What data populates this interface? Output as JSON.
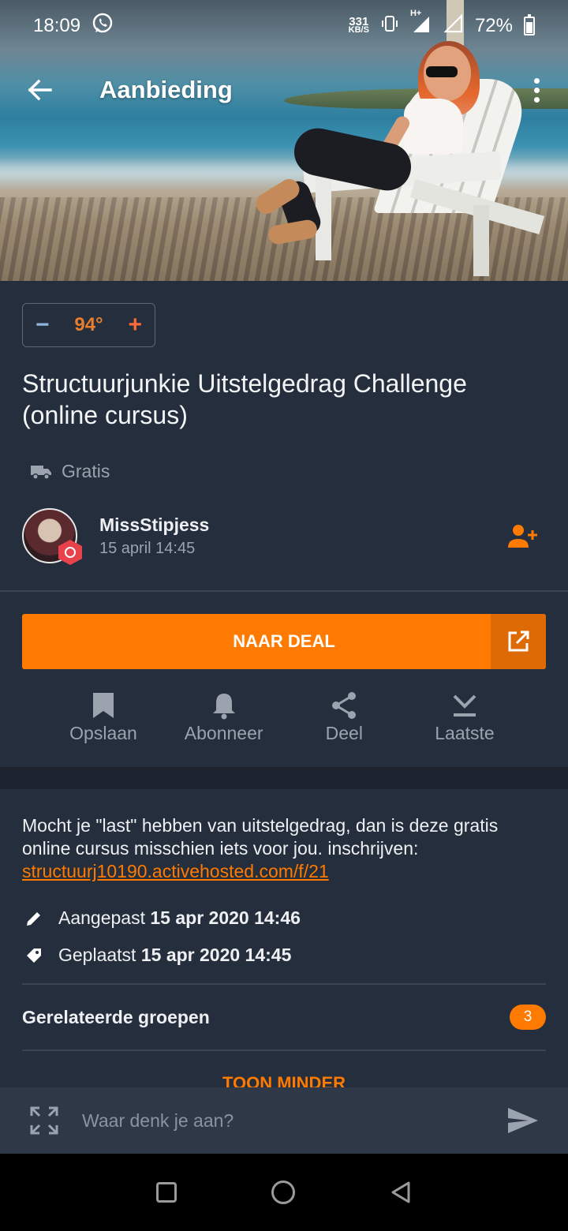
{
  "status_bar": {
    "time": "18:09",
    "net_speed_value": "331",
    "net_speed_unit": "KB/S",
    "network_type": "H+",
    "battery": "72%"
  },
  "app_bar": {
    "title": "Aanbieding"
  },
  "deal": {
    "temperature": "94°",
    "title": "Structuurjunkie Uitstelgedrag Challenge (online cursus)",
    "shipping": "Gratis",
    "poster": {
      "name": "MissStipjess",
      "posted": "15 april 14:45"
    },
    "cta_label": "NAAR DEAL",
    "description": "Mocht je \"last\" hebben van uitstelgedrag, dan is deze gratis online cursus misschien iets voor jou. inschrijven:",
    "link": "structuurj10190.activehosted.com/f/21",
    "edited_label": "Aangepast",
    "edited_date": "15 apr 2020 14:46",
    "placed_label": "Geplaatst",
    "placed_date": "15 apr 2020 14:45"
  },
  "actions": [
    {
      "label": "Opslaan",
      "icon": "bookmark-icon"
    },
    {
      "label": "Abonneer",
      "icon": "bell-icon"
    },
    {
      "label": "Deel",
      "icon": "share-icon"
    },
    {
      "label": "Laatste",
      "icon": "jump-to-latest-icon"
    }
  ],
  "groups": {
    "label": "Gerelateerde groepen",
    "count": "3"
  },
  "toggle_label": "TOON MINDER",
  "comment": {
    "placeholder": "Waar denk je aan?"
  },
  "colors": {
    "accent": "#ff7a00",
    "background": "#252e3c",
    "muted_text": "#9aa3ae"
  }
}
